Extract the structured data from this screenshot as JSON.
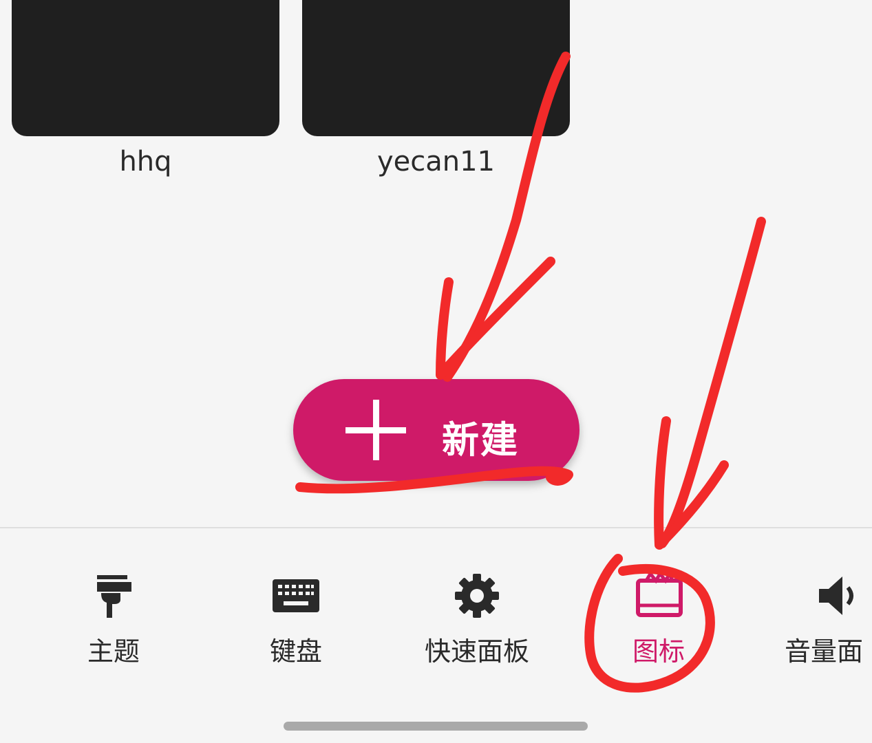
{
  "themes": [
    {
      "name": "hhq"
    },
    {
      "name": "yecan11"
    }
  ],
  "fab": {
    "label": "新建"
  },
  "nav": {
    "items": [
      {
        "label": "主题",
        "icon": "paint-brush-icon"
      },
      {
        "label": "键盘",
        "icon": "keyboard-icon"
      },
      {
        "label": "快速面板",
        "icon": "gear-icon"
      },
      {
        "label": "图标",
        "icon": "icon-palette-icon",
        "active": true
      },
      {
        "label": "音量面",
        "icon": "volume-icon"
      }
    ]
  },
  "colors": {
    "accent": "#cf1a68",
    "annotation": "#f22a2a",
    "card": "#1f1f1f",
    "background": "#f5f5f5"
  }
}
